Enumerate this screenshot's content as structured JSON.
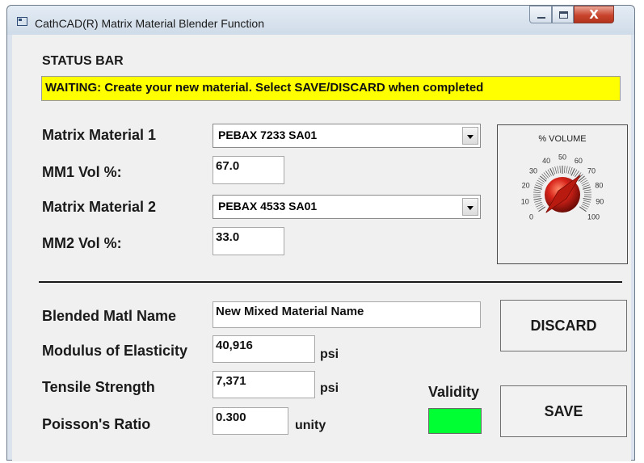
{
  "window": {
    "title": "CathCAD(R) Matrix Material Blender Function",
    "close_glyph": "X"
  },
  "status": {
    "heading": "STATUS BAR",
    "message": "WAITING: Create your new material. Select SAVE/DISCARD when completed",
    "color": "#ffff00"
  },
  "matrix1": {
    "label": "Matrix Material 1",
    "value": "PEBAX 7233 SA01"
  },
  "mm1_vol": {
    "label": "MM1 Vol %:",
    "value": "67.0"
  },
  "matrix2": {
    "label": "Matrix Material 2",
    "value": "PEBAX 4533 SA01"
  },
  "mm2_vol": {
    "label": "MM2 Vol %:",
    "value": "33.0"
  },
  "dial": {
    "title": "% VOLUME",
    "ticks": [
      "0",
      "10",
      "20",
      "30",
      "40",
      "50",
      "60",
      "70",
      "80",
      "90",
      "100"
    ],
    "value_percent": 67
  },
  "blended": {
    "label": "Blended Matl Name",
    "value": "New Mixed Material Name"
  },
  "modulus": {
    "label": "Modulus of Elasticity",
    "value": "40,916",
    "unit": "psi"
  },
  "tensile": {
    "label": "Tensile Strength",
    "value": "7,371",
    "unit": "psi"
  },
  "poisson": {
    "label": "Poisson's Ratio",
    "value": "0.300",
    "unit": "unity"
  },
  "validity": {
    "label": "Validity",
    "color": "#00ff33"
  },
  "buttons": {
    "discard": "DISCARD",
    "save": "SAVE"
  }
}
